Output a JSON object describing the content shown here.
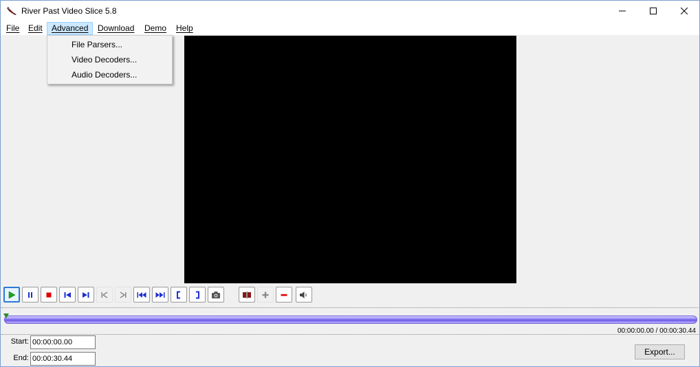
{
  "window": {
    "title": "River Past Video Slice 5.8"
  },
  "menu": {
    "file": "File",
    "edit": "Edit",
    "advanced": "Advanced",
    "download": "Download",
    "demo": "Demo",
    "help": "Help"
  },
  "advanced_menu": {
    "items": [
      "File Parsers...",
      "Video Decoders...",
      "Audio Decoders..."
    ]
  },
  "toolbar": {
    "buttons": [
      {
        "name": "play",
        "icon": "play-icon",
        "state": "pressed"
      },
      {
        "name": "pause",
        "icon": "pause-icon",
        "state": "normal"
      },
      {
        "name": "stop",
        "icon": "stop-icon",
        "state": "normal"
      },
      {
        "name": "previous-frame",
        "icon": "step-back-icon",
        "state": "normal"
      },
      {
        "name": "next-frame",
        "icon": "step-forward-icon",
        "state": "normal"
      },
      {
        "name": "go-to-start-mark",
        "icon": "skip-start-icon",
        "state": "disabled"
      },
      {
        "name": "go-to-end-mark",
        "icon": "skip-end-icon",
        "state": "disabled"
      },
      {
        "name": "rewind",
        "icon": "rewind-icon",
        "state": "normal"
      },
      {
        "name": "fast-forward",
        "icon": "fast-forward-icon",
        "state": "normal"
      },
      {
        "name": "mark-start",
        "icon": "bracket-open-icon",
        "state": "normal"
      },
      {
        "name": "mark-end",
        "icon": "bracket-close-icon",
        "state": "normal"
      },
      {
        "name": "snapshot",
        "icon": "camera-icon",
        "state": "normal"
      },
      {
        "name": "split",
        "icon": "split-icon",
        "state": "normal"
      },
      {
        "name": "add-segment",
        "icon": "plus-icon",
        "state": "disabled"
      },
      {
        "name": "remove-segment",
        "icon": "minus-icon",
        "state": "normal"
      },
      {
        "name": "volume",
        "icon": "speaker-icon",
        "state": "normal"
      }
    ]
  },
  "timeline": {
    "readout": "00:00:00.00 / 00:00:30.44",
    "position_fraction": 0
  },
  "fields": {
    "start_label": "Start:",
    "start_value": "00:00:00.00",
    "end_label": "End:",
    "end_value": "00:00:30.44"
  },
  "export_label": "Export...",
  "colors": {
    "play_green": "#1aa51a",
    "stop_red": "#e00000",
    "transport_blue": "#1c2fd1",
    "timeline_purple": "#7a6aeb",
    "menu_highlight": "#cce8ff"
  }
}
